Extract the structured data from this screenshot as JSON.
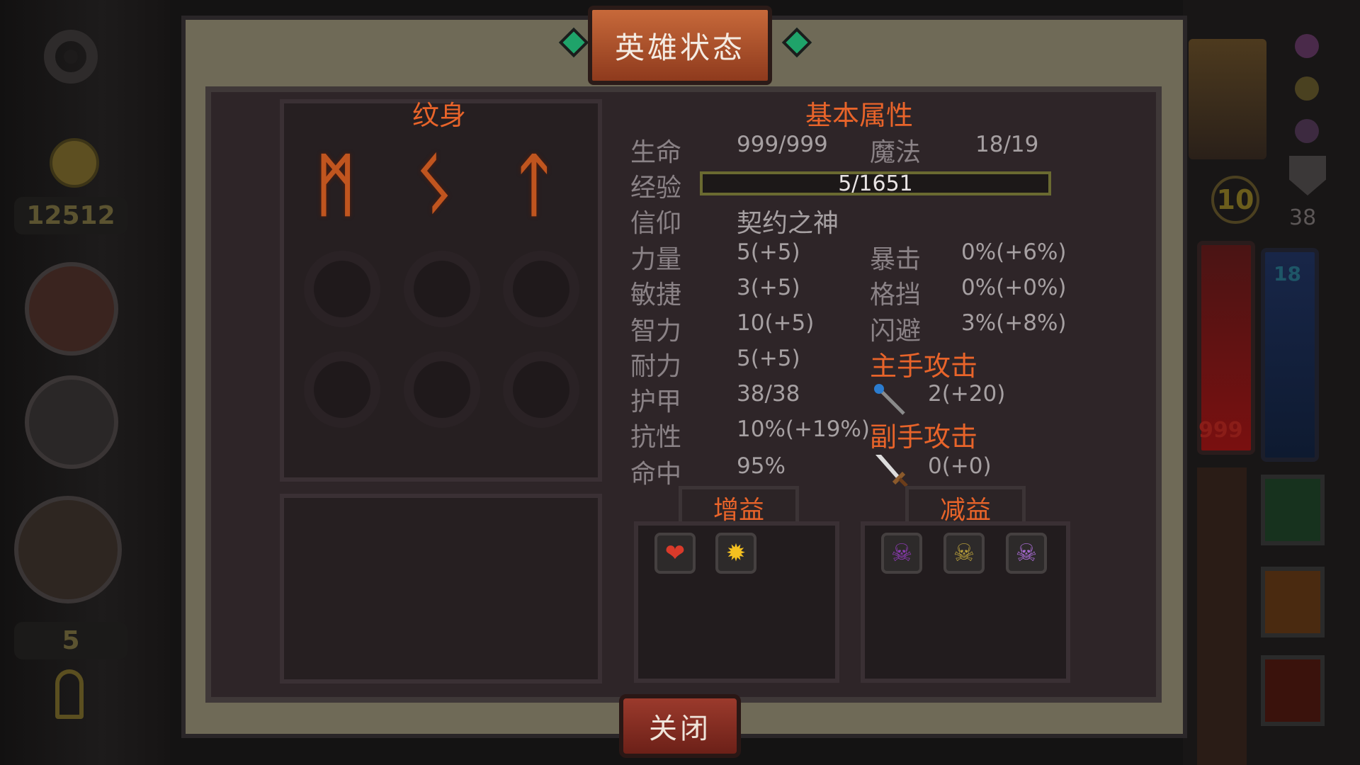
{
  "left_hud": {
    "gold": "12512",
    "keys": "5",
    "icons": [
      "gear-icon",
      "coin-icon",
      "bag-icon",
      "helmet-icon",
      "sword-shield-icon",
      "key-icon"
    ]
  },
  "right_hud": {
    "level": "10",
    "armor": "38",
    "hp_label": "999",
    "mp_label": "18"
  },
  "panel": {
    "title": "英雄状态",
    "tattoo_title": "纹身",
    "runes": [
      "ᛗ",
      "ᛊ",
      "ᛏ"
    ],
    "attr_title": "基本属性",
    "stats": {
      "hp_label": "生命",
      "hp_value": "999/999",
      "mp_label": "魔法",
      "mp_value": "18/19",
      "exp_label": "经验",
      "exp_value": "5/1651",
      "faith_label": "信仰",
      "faith_value": "契约之神",
      "str_label": "力量",
      "str_value": "5(+5)",
      "crit_label": "暴击",
      "crit_value": "0%(+6%)",
      "agi_label": "敏捷",
      "agi_value": "3(+5)",
      "block_label": "格挡",
      "block_value": "0%(+0%)",
      "int_label": "智力",
      "int_value": "10(+5)",
      "dodge_label": "闪避",
      "dodge_value": "3%(+8%)",
      "sta_label": "耐力",
      "sta_value": "5(+5)",
      "armor_label": "护甲",
      "armor_value": "38/38",
      "res_label": "抗性",
      "res_value": "10%(+19%)",
      "hit_label": "命中",
      "hit_value": "95%",
      "main_attack_label": "主手攻击",
      "main_attack_value": "2(+20)",
      "off_attack_label": "副手攻击",
      "off_attack_value": "0(+0)"
    },
    "buff_title": "增益",
    "debuff_title": "减益",
    "close_label": "关闭"
  }
}
